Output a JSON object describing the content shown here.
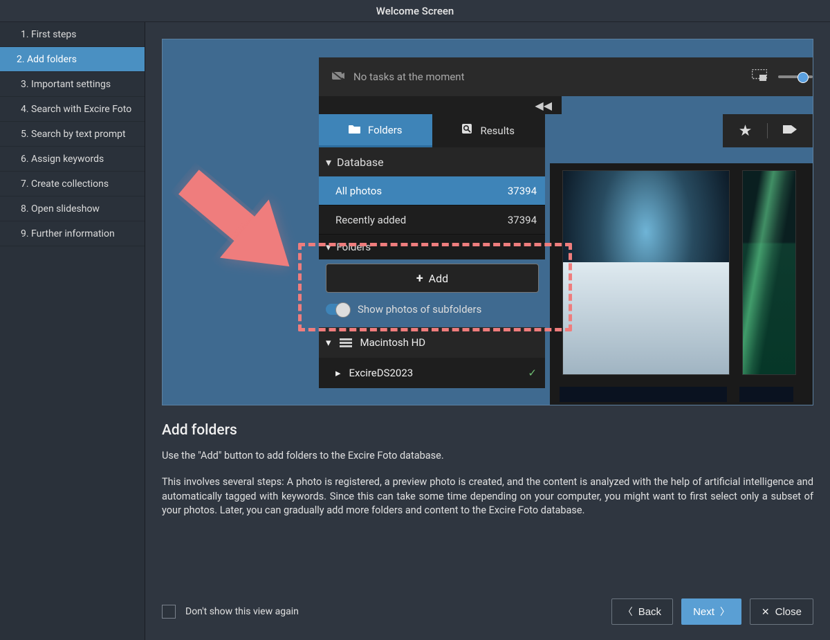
{
  "header": {
    "title": "Welcome Screen"
  },
  "sidebar": {
    "items": [
      {
        "label": "1. First steps"
      },
      {
        "label": "2. Add folders"
      },
      {
        "label": "3. Important settings"
      },
      {
        "label": "4. Search with Excire Foto"
      },
      {
        "label": "5. Search by text prompt"
      },
      {
        "label": "6. Assign keywords"
      },
      {
        "label": "7. Create collections"
      },
      {
        "label": "8. Open slideshow"
      },
      {
        "label": "9. Further information"
      }
    ],
    "active_index": 1
  },
  "screenshot": {
    "status_text": "No tasks at the moment",
    "tabs": {
      "folders": "Folders",
      "results": "Results"
    },
    "database_header": "Database",
    "all_photos": {
      "label": "All photos",
      "count": "37394"
    },
    "recently_added": {
      "label": "Recently added",
      "count": "37394"
    },
    "folders_header": "Folders",
    "add_button": "Add",
    "subfolders_label": "Show photos of subfolders",
    "drive_name": "Macintosh HD",
    "folder_name": "ExcireDS2023"
  },
  "article": {
    "title": "Add folders",
    "p1": "Use the \"Add\" button to add folders to the Excire Foto database.",
    "p2": "This involves several steps: A photo is registered, a preview photo is created, and the content is analyzed with the help of artificial intelligence and automatically tagged with keywords. Since this can take some time depending on your computer, you might want to first select only a subset of your photos. Later, you can gradually add more folders and content to the Excire Foto database."
  },
  "footer": {
    "dont_show": "Don't show this view again",
    "back": "Back",
    "next": "Next",
    "close": "Close"
  }
}
